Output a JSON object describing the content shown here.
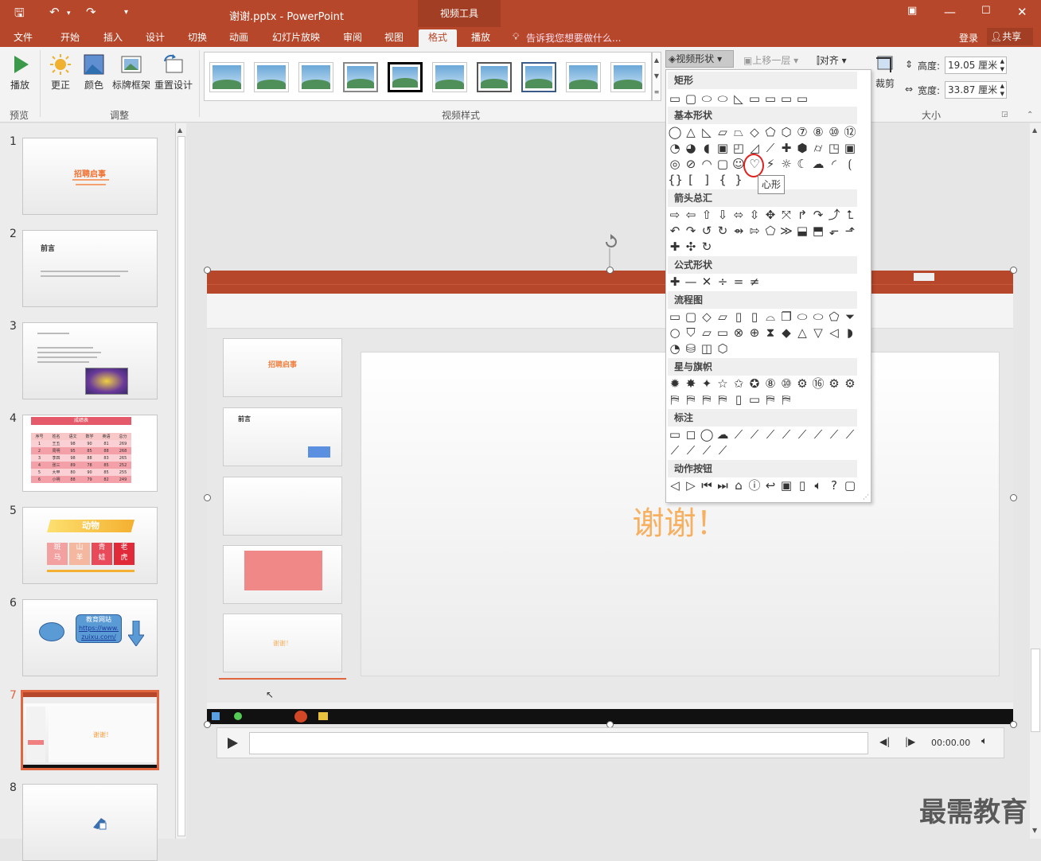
{
  "title": {
    "file": "谢谢.pptx - PowerPoint",
    "context": "视频工具"
  },
  "tabs": [
    "文件",
    "开始",
    "插入",
    "设计",
    "切换",
    "动画",
    "幻灯片放映",
    "审阅",
    "视图",
    "格式",
    "播放"
  ],
  "tell_me": "告诉我您想要做什么...",
  "account": {
    "login": "登录",
    "share": "共享"
  },
  "ribbon": {
    "play": "播放",
    "preview": "预览",
    "correct": "更正",
    "color": "颜色",
    "poster": "标牌框架",
    "reset": "重置设计",
    "adjust": "调整",
    "video_styles": "视频样式",
    "video_shape": "视频形状",
    "bring_forward": "上移一层",
    "align": "对齐",
    "crop": "裁剪",
    "height_label": "高度:",
    "height_value": "19.05 厘米",
    "width_label": "宽度:",
    "width_value": "33.87 厘米",
    "size": "大小"
  },
  "thumbs": {
    "n": [
      "1",
      "2",
      "3",
      "4",
      "5",
      "6",
      "7",
      "8"
    ],
    "s1_title": "招聘启事",
    "s2_title": "前言",
    "s4_title": "成绩表",
    "s4_headers": [
      "序号",
      "姓名",
      "语文",
      "数学",
      "英语",
      "总分"
    ],
    "s4_rows": [
      [
        "1",
        "王五",
        "98",
        "90",
        "81",
        "269"
      ],
      [
        "2",
        "周明",
        "95",
        "85",
        "88",
        "268"
      ],
      [
        "3",
        "李四",
        "98",
        "88",
        "83",
        "265"
      ],
      [
        "4",
        "张三",
        "89",
        "78",
        "85",
        "252"
      ],
      [
        "5",
        "大甲",
        "80",
        "90",
        "85",
        "255"
      ],
      [
        "6",
        "小明",
        "88",
        "79",
        "82",
        "249"
      ]
    ],
    "s5_title": "动物",
    "s5_cells": [
      "斑\n马",
      "山\n羊",
      "青\n蛙",
      "老\n虎"
    ],
    "s6_box": "教育网站",
    "s6_link1": "https://www.",
    "s6_link2": "zuixu.com/",
    "s7_text": "谢谢！"
  },
  "video": {
    "slide_text": "谢谢！",
    "inner_thumb1": "招聘启事",
    "inner_thumb2": "前言",
    "inner_thumb5": "谢谢！",
    "time": "00:00.00"
  },
  "dropdown": {
    "sections": [
      "矩形",
      "基本形状",
      "箭头总汇",
      "公式形状",
      "流程图",
      "星与旗帜",
      "标注",
      "动作按钮"
    ],
    "tooltip": "心形"
  },
  "watermark": "最需教育",
  "colors": {
    "accent": "#b7472a",
    "highlight": "#e0663f",
    "circle": "#e02020"
  }
}
